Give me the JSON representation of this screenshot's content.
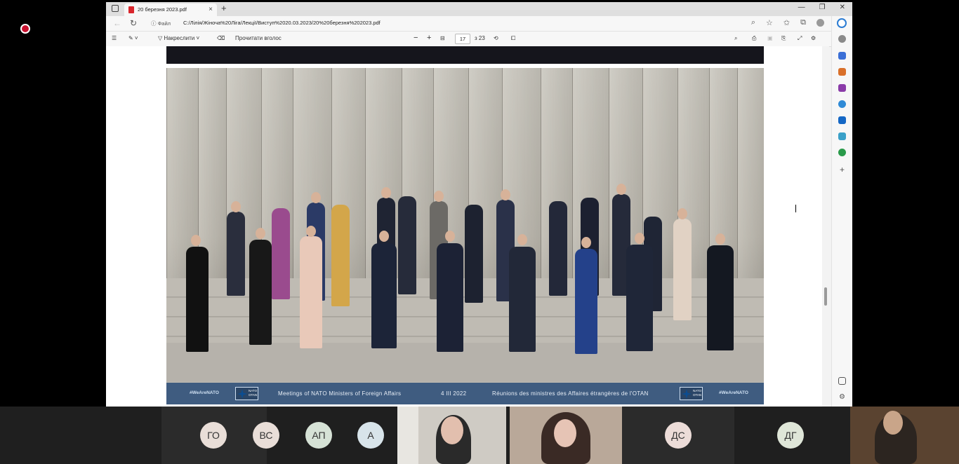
{
  "browser": {
    "tab_title": "20 березня 2023.pdf",
    "address_scheme_label": "Файл",
    "address_url": "C:/Лілія/Жіноча%20Ліга/Лекції/Виступ%2020.03.2023/20%20березня%202023.pdf",
    "window_controls": [
      "—",
      "❐",
      "✕"
    ]
  },
  "pdf_toolbar": {
    "draw_label": "Накреслити",
    "read_aloud_label": "Прочитати вголос",
    "zoom_out": "−",
    "zoom_in": "+",
    "current_page": "17",
    "total_pages": "з 23"
  },
  "photo_banner": {
    "hashtag_left": "#WeAreNATO",
    "hashtag_right": "#WeAreNATO",
    "logo_text": "NATO OTAN",
    "english_text": "Meetings of NATO Ministers of Foreign Affairs",
    "date": "4 III 2022",
    "french_text": "Réunions des ministres des Affaires étrangères de l'OTAN"
  },
  "participants": [
    {
      "initials": "ГО"
    },
    {
      "initials": "ВС"
    },
    {
      "initials": "АП"
    },
    {
      "initials": "А"
    },
    {
      "initials": "ДС"
    },
    {
      "initials": "ДГ"
    }
  ],
  "colors": {
    "banner": "#3f5c80",
    "participant_bg": "#2b2b2b",
    "avatar_bg": "#e9ded8",
    "recording": "#c8102e"
  }
}
